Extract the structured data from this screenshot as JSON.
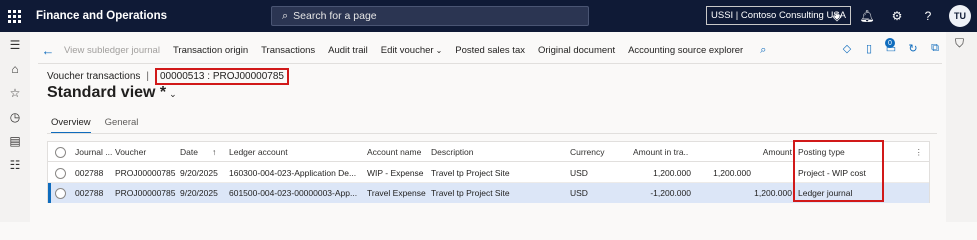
{
  "topbar": {
    "app_title": "Finance and Operations",
    "search_placeholder": "Search for a page",
    "company": "USSI | Contoso Consulting USA",
    "avatar_initials": "TU",
    "icons": [
      "waffle-icon",
      "search-icon",
      "copilot-icon",
      "bell-icon",
      "gear-icon",
      "help-icon"
    ]
  },
  "left_nav": {
    "icons": [
      "hamburger-icon",
      "home-icon",
      "star-icon",
      "clock-icon",
      "workspace-icon",
      "list-icon"
    ]
  },
  "action_bar": {
    "items": [
      {
        "label": "View subledger journal",
        "disabled": true
      },
      {
        "label": "Transaction origin",
        "disabled": false
      },
      {
        "label": "Transactions",
        "disabled": false
      },
      {
        "label": "Audit trail",
        "disabled": false
      },
      {
        "label": "Edit voucher",
        "disabled": false,
        "dropdown": true
      },
      {
        "label": "Posted sales tax",
        "disabled": false
      },
      {
        "label": "Original document",
        "disabled": false
      },
      {
        "label": "Accounting source explorer",
        "disabled": false
      }
    ],
    "notification_count": "0",
    "right_icons": [
      "diamond-icon",
      "office-icon",
      "notification-icon",
      "refresh-icon",
      "popout-icon"
    ]
  },
  "breadcrumb": {
    "page": "Voucher transactions",
    "separator": "|",
    "record": "00000513 : PROJ00000785"
  },
  "view": {
    "title": "Standard view *",
    "chevron": "⌄"
  },
  "tabs": [
    {
      "label": "Overview",
      "active": true
    },
    {
      "label": "General",
      "active": false
    }
  ],
  "grid": {
    "columns": {
      "journal": "Journal ...",
      "voucher": "Voucher",
      "date": "Date",
      "sort_indicator": "↑",
      "ledger_account": "Ledger account",
      "account_name": "Account name",
      "description": "Description",
      "currency": "Currency",
      "amount_in_tra": "Amount in tra...",
      "amount": "Amount",
      "posting_type": "Posting type"
    },
    "rows": [
      {
        "journal": "002788",
        "voucher": "PROJ00000785",
        "date": "9/20/2025",
        "ledger_account": "160300-004-023-Application De...",
        "account_name": "WIP - Expense",
        "description": "Travel tp Project Site",
        "currency": "USD",
        "amount_in_tra": "1,200.000",
        "amount": "1,200.000",
        "posting_type": "Project - WIP cost",
        "selected": false
      },
      {
        "journal": "002788",
        "voucher": "PROJ00000785",
        "date": "9/20/2025",
        "ledger_account": "601500-004-023-00000003-App...",
        "account_name": "Travel Expense",
        "description": "Travel tp Project Site",
        "currency": "USD",
        "amount_in_tra": "-1,200.000",
        "amount": "1,200.000",
        "posting_type": "Ledger journal",
        "selected": true
      }
    ]
  },
  "colors": {
    "topbar_bg": "#0f1a36",
    "accent": "#0f6cbd",
    "highlight_box": "#d11919",
    "selected_row": "#dce6f7"
  }
}
